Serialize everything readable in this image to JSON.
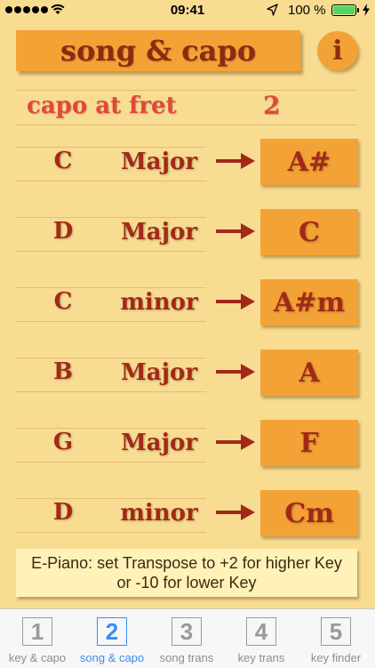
{
  "status_bar": {
    "time": "09:41",
    "battery": "100 %"
  },
  "title": "song & capo",
  "info_button": "i",
  "capo": {
    "label": "capo at fret",
    "value": "2"
  },
  "rows": [
    {
      "note": "C",
      "quality": "Major",
      "result": "A#"
    },
    {
      "note": "D",
      "quality": "Major",
      "result": "C"
    },
    {
      "note": "C",
      "quality": "minor",
      "result": "A#m"
    },
    {
      "note": "B",
      "quality": "Major",
      "result": "A"
    },
    {
      "note": "G",
      "quality": "Major",
      "result": "F"
    },
    {
      "note": "D",
      "quality": "minor",
      "result": "Cm"
    }
  ],
  "info_text": "E-Piano: set Transpose to +2 for higher Key or -10 for lower Key",
  "tabs": [
    {
      "number": "1",
      "label": "key & capo"
    },
    {
      "number": "2",
      "label": "song & capo"
    },
    {
      "number": "3",
      "label": "song trans"
    },
    {
      "number": "4",
      "label": "key trans"
    },
    {
      "number": "5",
      "label": "key finder"
    }
  ],
  "colors": {
    "background": "#f8dc92",
    "button": "#f3a335",
    "text_dark_red": "#a22918",
    "capo_red": "#e2483a",
    "tab_active": "#3b8cf5"
  }
}
